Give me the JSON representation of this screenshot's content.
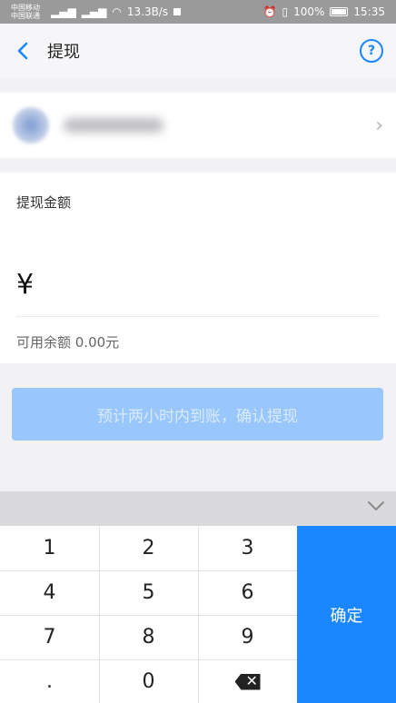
{
  "status_bar": {
    "carrier1": "中国移动",
    "carrier2": "中国联通",
    "net_speed": "13.3B/s",
    "battery": "100%",
    "time": "15:35"
  },
  "header": {
    "title": "提现",
    "help_icon": "?"
  },
  "amount": {
    "label": "提现金额",
    "currency": "¥",
    "input_value": "",
    "available": "可用余额 0.00元"
  },
  "confirm_button": "预计两小时内到账，确认提现",
  "keypad": {
    "keys": [
      "1",
      "2",
      "3",
      "4",
      "5",
      "6",
      "7",
      "8",
      "9",
      ".",
      "0"
    ],
    "ok_label": "确定",
    "collapse_icon": "chevron-down-icon",
    "delete_icon": "backspace-icon"
  },
  "colors": {
    "accent": "#1a86ff",
    "button_disabled": "#99c6fb"
  }
}
